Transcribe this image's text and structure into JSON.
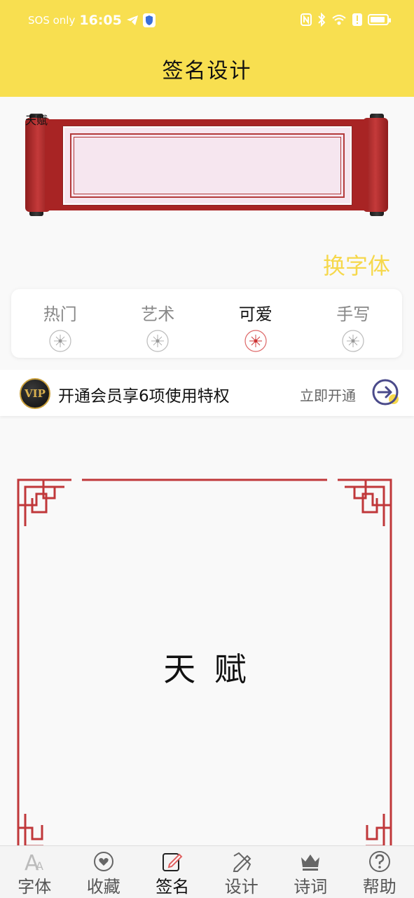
{
  "status": {
    "carrier": "SOS only",
    "time": "16:05",
    "icons": [
      "telegram-icon",
      "shield-icon",
      "nfc-icon",
      "bluetooth-icon",
      "wifi-icon",
      "alert-icon",
      "battery-icon"
    ]
  },
  "header": {
    "title": "签名设计"
  },
  "preview": {
    "name": "天赋"
  },
  "switch_font_label": "换字体",
  "categories": [
    {
      "label": "热门",
      "active": false
    },
    {
      "label": "艺术",
      "active": false
    },
    {
      "label": "可爱",
      "active": true
    },
    {
      "label": "手写",
      "active": false
    }
  ],
  "vip": {
    "badge": "VIP",
    "text": "开通会员享6项使用特权",
    "cta": "立即开通"
  },
  "canvas": {
    "signature": "天 赋"
  },
  "bottom_nav": [
    {
      "label": "字体",
      "icon": "font-icon",
      "active": false
    },
    {
      "label": "收藏",
      "icon": "heart-icon",
      "active": false
    },
    {
      "label": "签名",
      "icon": "edit-icon",
      "active": true
    },
    {
      "label": "设计",
      "icon": "design-icon",
      "active": false
    },
    {
      "label": "诗词",
      "icon": "crown-icon",
      "active": false
    },
    {
      "label": "帮助",
      "icon": "help-icon",
      "active": false
    }
  ],
  "colors": {
    "header": "#f8df50",
    "accent": "#f6d84c",
    "frame_red": "#b33a3a"
  }
}
